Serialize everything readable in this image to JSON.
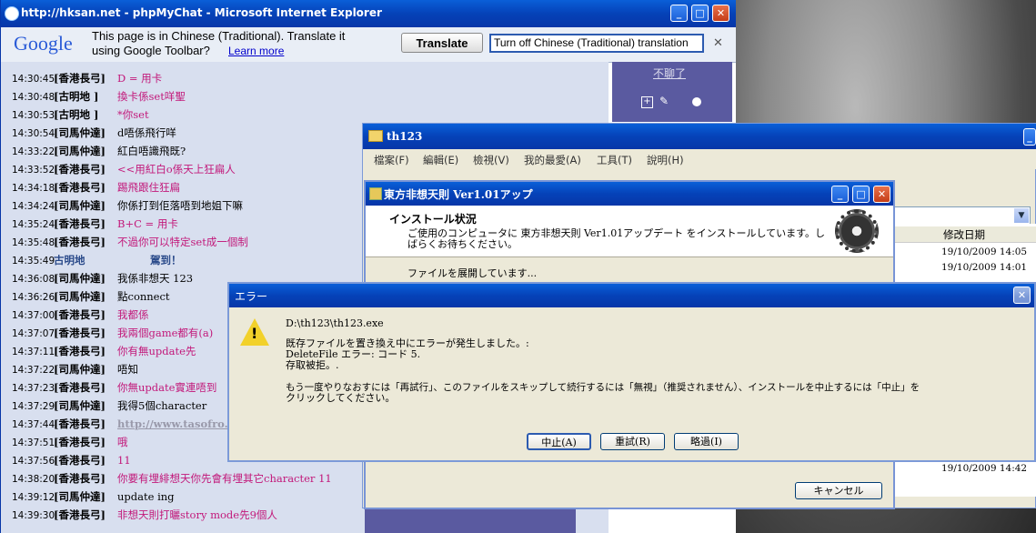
{
  "ie": {
    "title": "http://hksan.net - phpMyChat - Microsoft Internet Explorer",
    "google_toolbar": {
      "logo": "Google",
      "message_line1": "This page is in Chinese (Traditional).  Translate it",
      "message_line2": "using Google Toolbar?",
      "learn_more": "Learn more",
      "translate_button": "Translate",
      "turn_off_button": "Turn off Chinese (Traditional) translation",
      "close": "✕"
    },
    "side_link": "不聊了"
  },
  "chat": {
    "messages": [
      {
        "time": "14:30:45",
        "name": "[香港長弓]",
        "text": "D = 用卡",
        "color": "pink"
      },
      {
        "time": "14:30:48",
        "name": "[古明地          ]",
        "text": "換卡係set咩聖",
        "color": "pink"
      },
      {
        "time": "14:30:53",
        "name": "[古明地          ]",
        "text": "*你set",
        "color": "pink"
      },
      {
        "time": "14:30:54",
        "name": "[司馬仲達]",
        "text": "d唔係飛行咩",
        "color": "black"
      },
      {
        "time": "14:33:22",
        "name": "[司馬仲達]",
        "text": "紅白唔識飛既?",
        "color": "black"
      },
      {
        "time": "14:33:52",
        "name": "[香港長弓]",
        "text": "<<用紅白o係天上狂扁人",
        "color": "pink"
      },
      {
        "time": "14:34:18",
        "name": "[香港長弓]",
        "text": "踢飛跟住狂扁",
        "color": "pink"
      },
      {
        "time": "14:34:24",
        "name": "[司馬仲達]",
        "text": "你係打到佢落唔到地姐下嘛",
        "color": "black"
      },
      {
        "time": "14:35:24",
        "name": "[香港長弓]",
        "text": "B+C = 用卡",
        "color": "pink"
      },
      {
        "time": "14:35:48",
        "name": "[香港長弓]",
        "text": "不過你可以特定set成一個制",
        "color": "pink"
      },
      {
        "time": "14:35:49",
        "name": "古明地",
        "text": "駕到！",
        "color": "system"
      },
      {
        "time": "14:36:08",
        "name": "[司馬仲達]",
        "text": "我係非想天 123",
        "color": "black"
      },
      {
        "time": "14:36:26",
        "name": "[司馬仲達]",
        "text": "點connect",
        "color": "black"
      },
      {
        "time": "14:37:00",
        "name": "[香港長弓]",
        "text": "我都係",
        "color": "pink"
      },
      {
        "time": "14:37:07",
        "name": "[香港長弓]",
        "text": "我兩個game都有(a)",
        "color": "pink"
      },
      {
        "time": "14:37:11",
        "name": "[香港長弓]",
        "text": "你有無update先",
        "color": "pink"
      },
      {
        "time": "14:37:22",
        "name": "[司馬仲達]",
        "text": "唔知",
        "color": "black"
      },
      {
        "time": "14:37:23",
        "name": "[香港長弓]",
        "text": "你無update實連唔到",
        "color": "pink"
      },
      {
        "time": "14:37:29",
        "name": "[司馬仲達]",
        "text": "我得5個character",
        "color": "black"
      },
      {
        "time": "14:37:44",
        "name": "[香港長弓]",
        "text": "http://www.tasofro.",
        "color": "link"
      },
      {
        "time": "14:37:51",
        "name": "[香港長弓]",
        "text": "哦",
        "color": "pink"
      },
      {
        "time": "14:37:56",
        "name": "[香港長弓]",
        "text": "11",
        "color": "pink"
      },
      {
        "time": "14:38:20",
        "name": "[香港長弓]",
        "text": "你要有埋緋想天你先會有埋其它character 11",
        "color": "pink"
      },
      {
        "time": "14:39:12",
        "name": "[司馬仲達]",
        "text": "update ing",
        "color": "black"
      },
      {
        "time": "14:39:30",
        "name": "[香港長弓]",
        "text": "非想天則打曬story mode先9個人",
        "color": "pink"
      }
    ]
  },
  "explorer": {
    "title": "th123",
    "menu": [
      "檔案(F)",
      "編輯(E)",
      "檢視(V)",
      "我的最愛(A)",
      "工具(T)",
      "說明(H)"
    ],
    "column_header": "修改日期",
    "dates": [
      "19/10/2009 14:05",
      "19/10/2009 14:01",
      "19/10/2009 14:42"
    ]
  },
  "installer": {
    "title": "東方非想天則 Ver1.01アップ",
    "header_title": "インストール状況",
    "header_line1": "ご使用のコンピュータに 東方非想天則 Ver1.01アップデート をインストールしています。し",
    "header_line2": "ばらくお待ちください。",
    "status": "ファイルを展開しています...",
    "cancel_button": "キャンセル"
  },
  "error": {
    "title": "エラー",
    "path": "D:\\th123\\th123.exe",
    "line1": "既存ファイルを置き換え中にエラーが発生しました。:",
    "line2": "DeleteFile エラー: コード 5.",
    "line3": "存取被拒。.",
    "line4": "もう一度やりなおすには「再試行」、このファイルをスキップして続行するには「無視」（推奨されません）、インストールを中止するには「中止」を",
    "line5": "クリックしてください。",
    "abort_button": "中止(A)",
    "retry_button": "重試(R)",
    "ignore_button": "略過(I)"
  }
}
